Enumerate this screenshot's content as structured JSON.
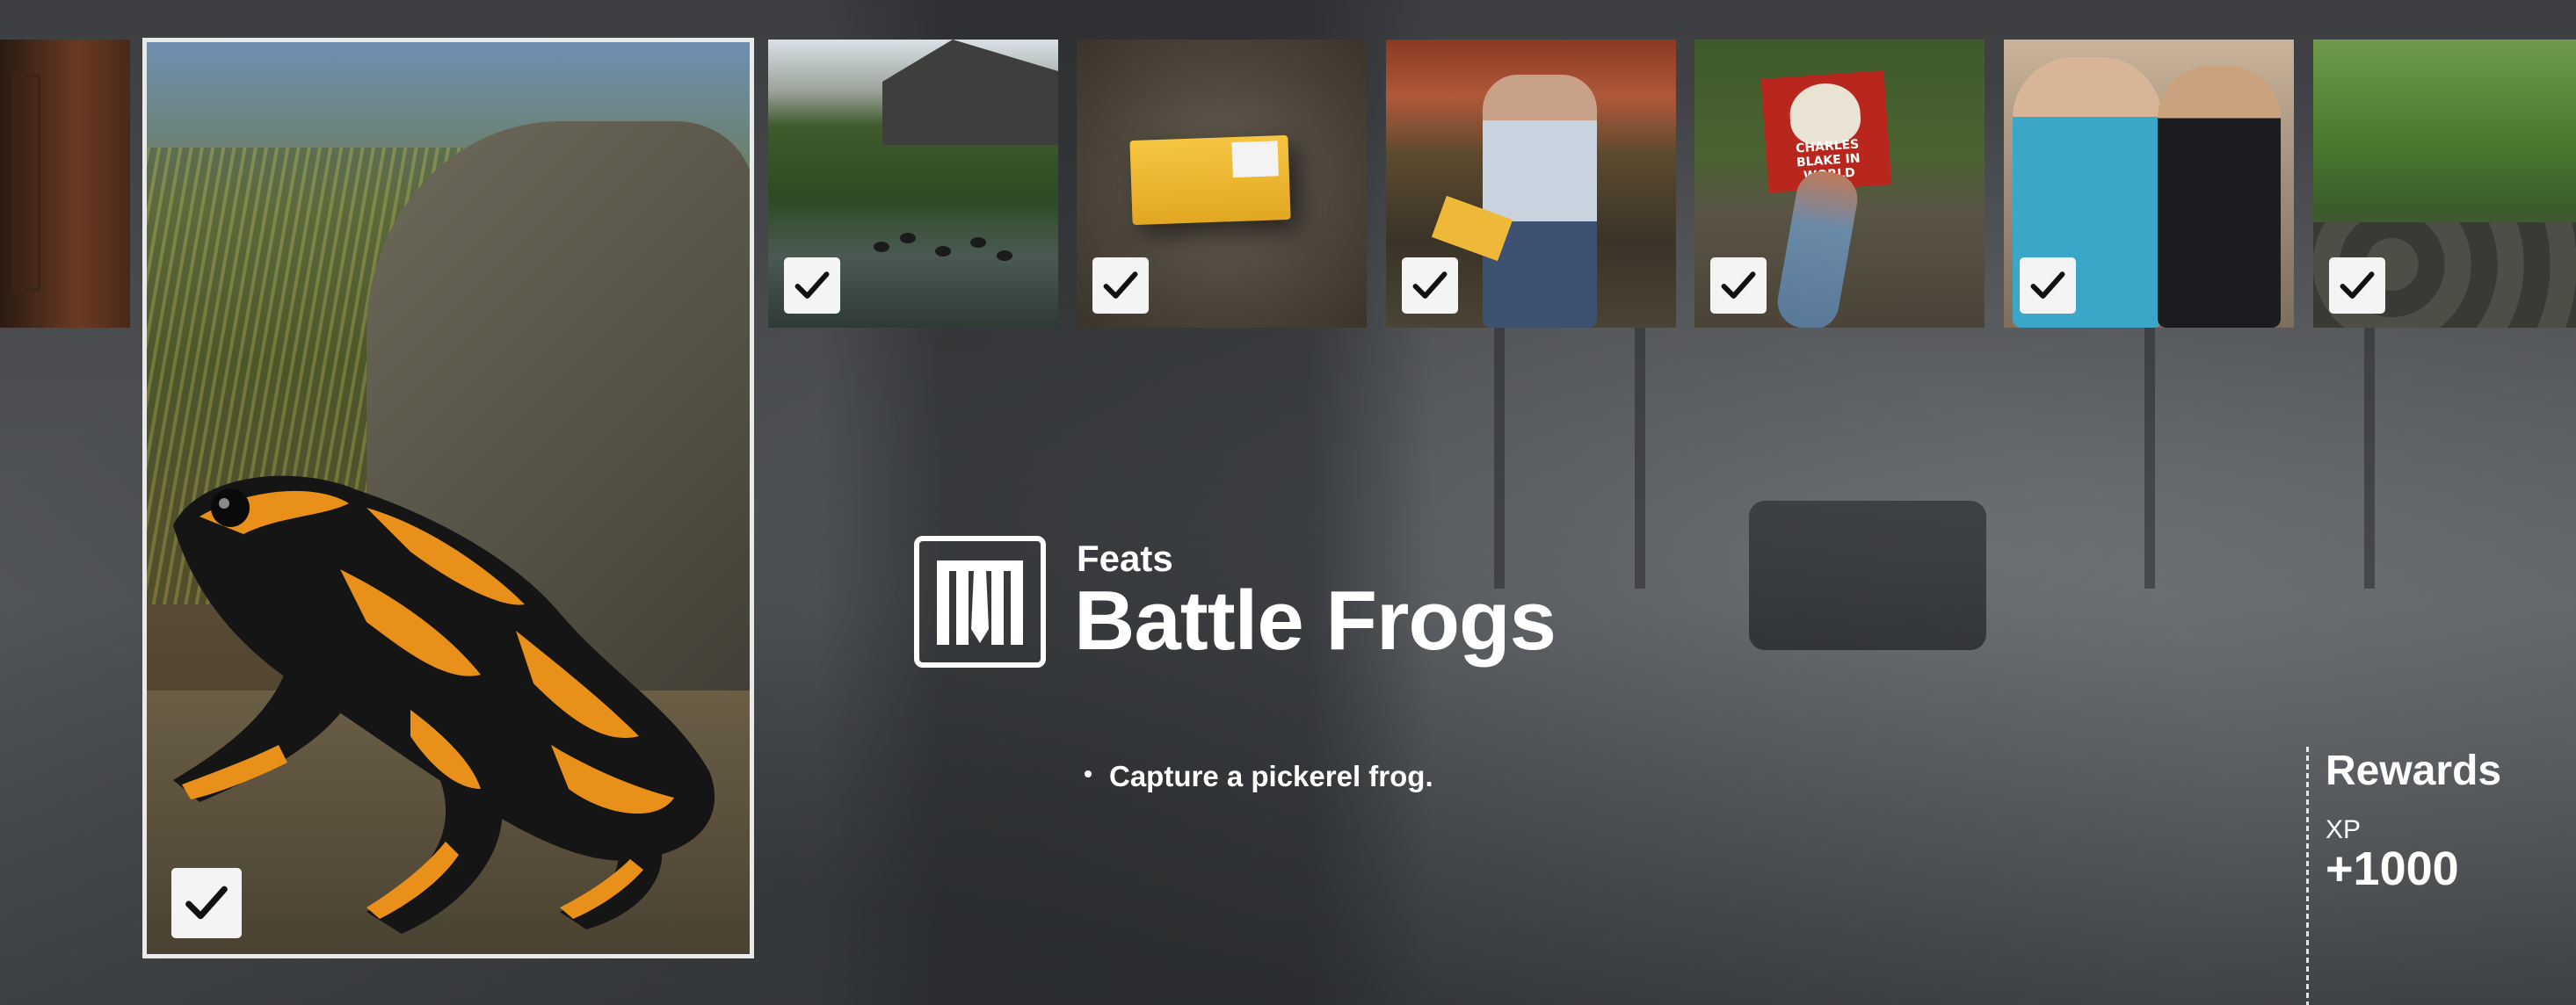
{
  "gallery": {
    "hero": {
      "image": "yellow-banded-poison-frog",
      "completed": true
    },
    "thumbnails": [
      {
        "image": "pond-with-ducks",
        "completed": true
      },
      {
        "image": "yellow-package-on-ground",
        "completed": true
      },
      {
        "image": "postman-holding-package",
        "completed": true
      },
      {
        "image": "charles-blake-poster",
        "completed": true
      },
      {
        "image": "bald-agent-and-man-in-suit",
        "completed": true
      },
      {
        "image": "park-with-rocks",
        "completed": true
      }
    ],
    "check_icon": "checkmark-icon"
  },
  "challenge": {
    "category": "Feats",
    "title": "Battle Frogs",
    "icon": "feats-icon",
    "objectives": [
      "Capture a pickerel frog."
    ]
  },
  "poster_text": "CHARLES BLAKE IN\nWORLD",
  "rewards": {
    "heading": "Rewards",
    "xp_label": "XP",
    "xp_value": "+1000"
  },
  "colors": {
    "accent": "#ffffff",
    "check_bg": "#f4f4f4",
    "hero_border": "#e9e9e9",
    "frog_orange": "#e8901a"
  }
}
